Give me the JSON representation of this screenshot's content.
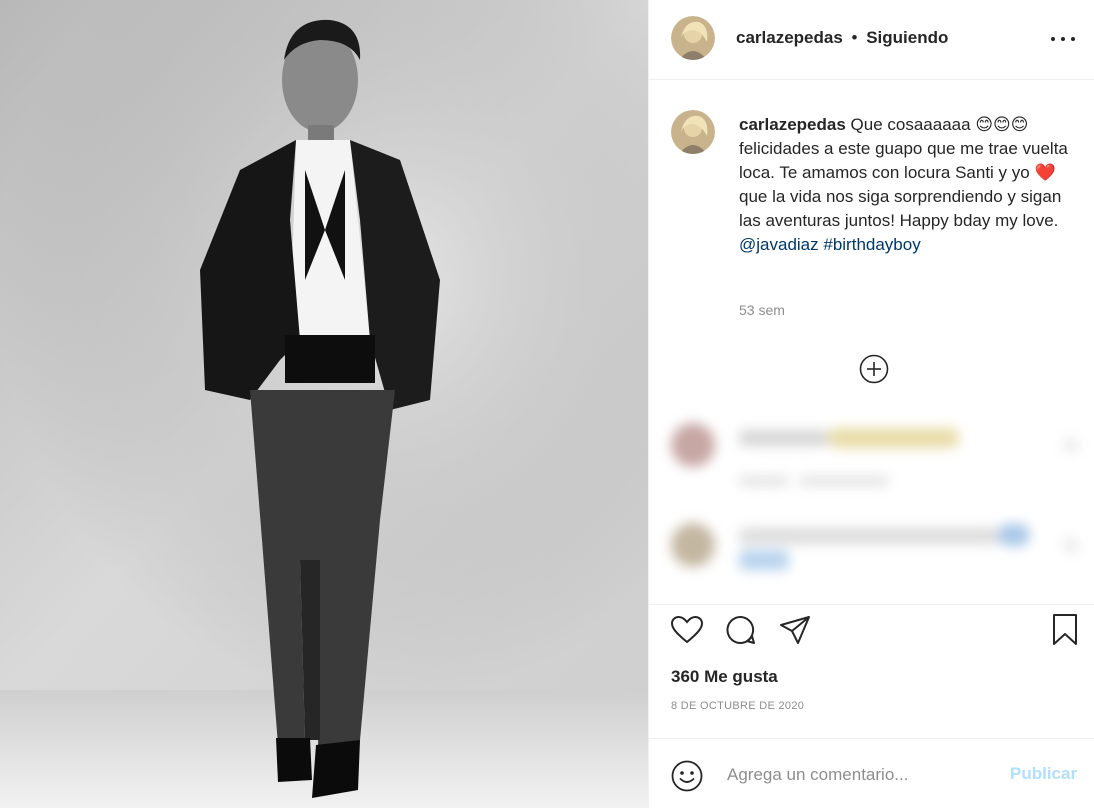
{
  "post": {
    "username": "carlazepedas",
    "follow_status": "Siguiendo",
    "caption_text": "Que cosaaaaaa",
    "caption_emoji_1": "😊😊😊",
    "caption_text_2": "felicidades a este guapo que me trae vuelta loca. Te amamos con locura Santi y yo",
    "caption_emoji_2": "❤️",
    "caption_text_3": "que la vida nos siga sorprendiendo y sigan las aventuras juntos! Happy bday my love.",
    "mention": "@javadiaz",
    "hashtag": "#birthdayboy",
    "time_ago": "53 sem",
    "likes": "360 Me gusta",
    "date": "8 DE OCTUBRE DE 2020"
  },
  "comment_box": {
    "placeholder": "Agrega un comentario...",
    "publish_label": "Publicar"
  },
  "icons": [
    "more-options-icon",
    "plus-circle-icon",
    "heart-icon",
    "comment-icon",
    "share-icon",
    "bookmark-icon",
    "emoji-icon"
  ],
  "colors": {
    "link": "#00376b",
    "publish_disabled": "#b2dffc",
    "muted": "#8e8e8e",
    "heart": "#e0245e"
  }
}
